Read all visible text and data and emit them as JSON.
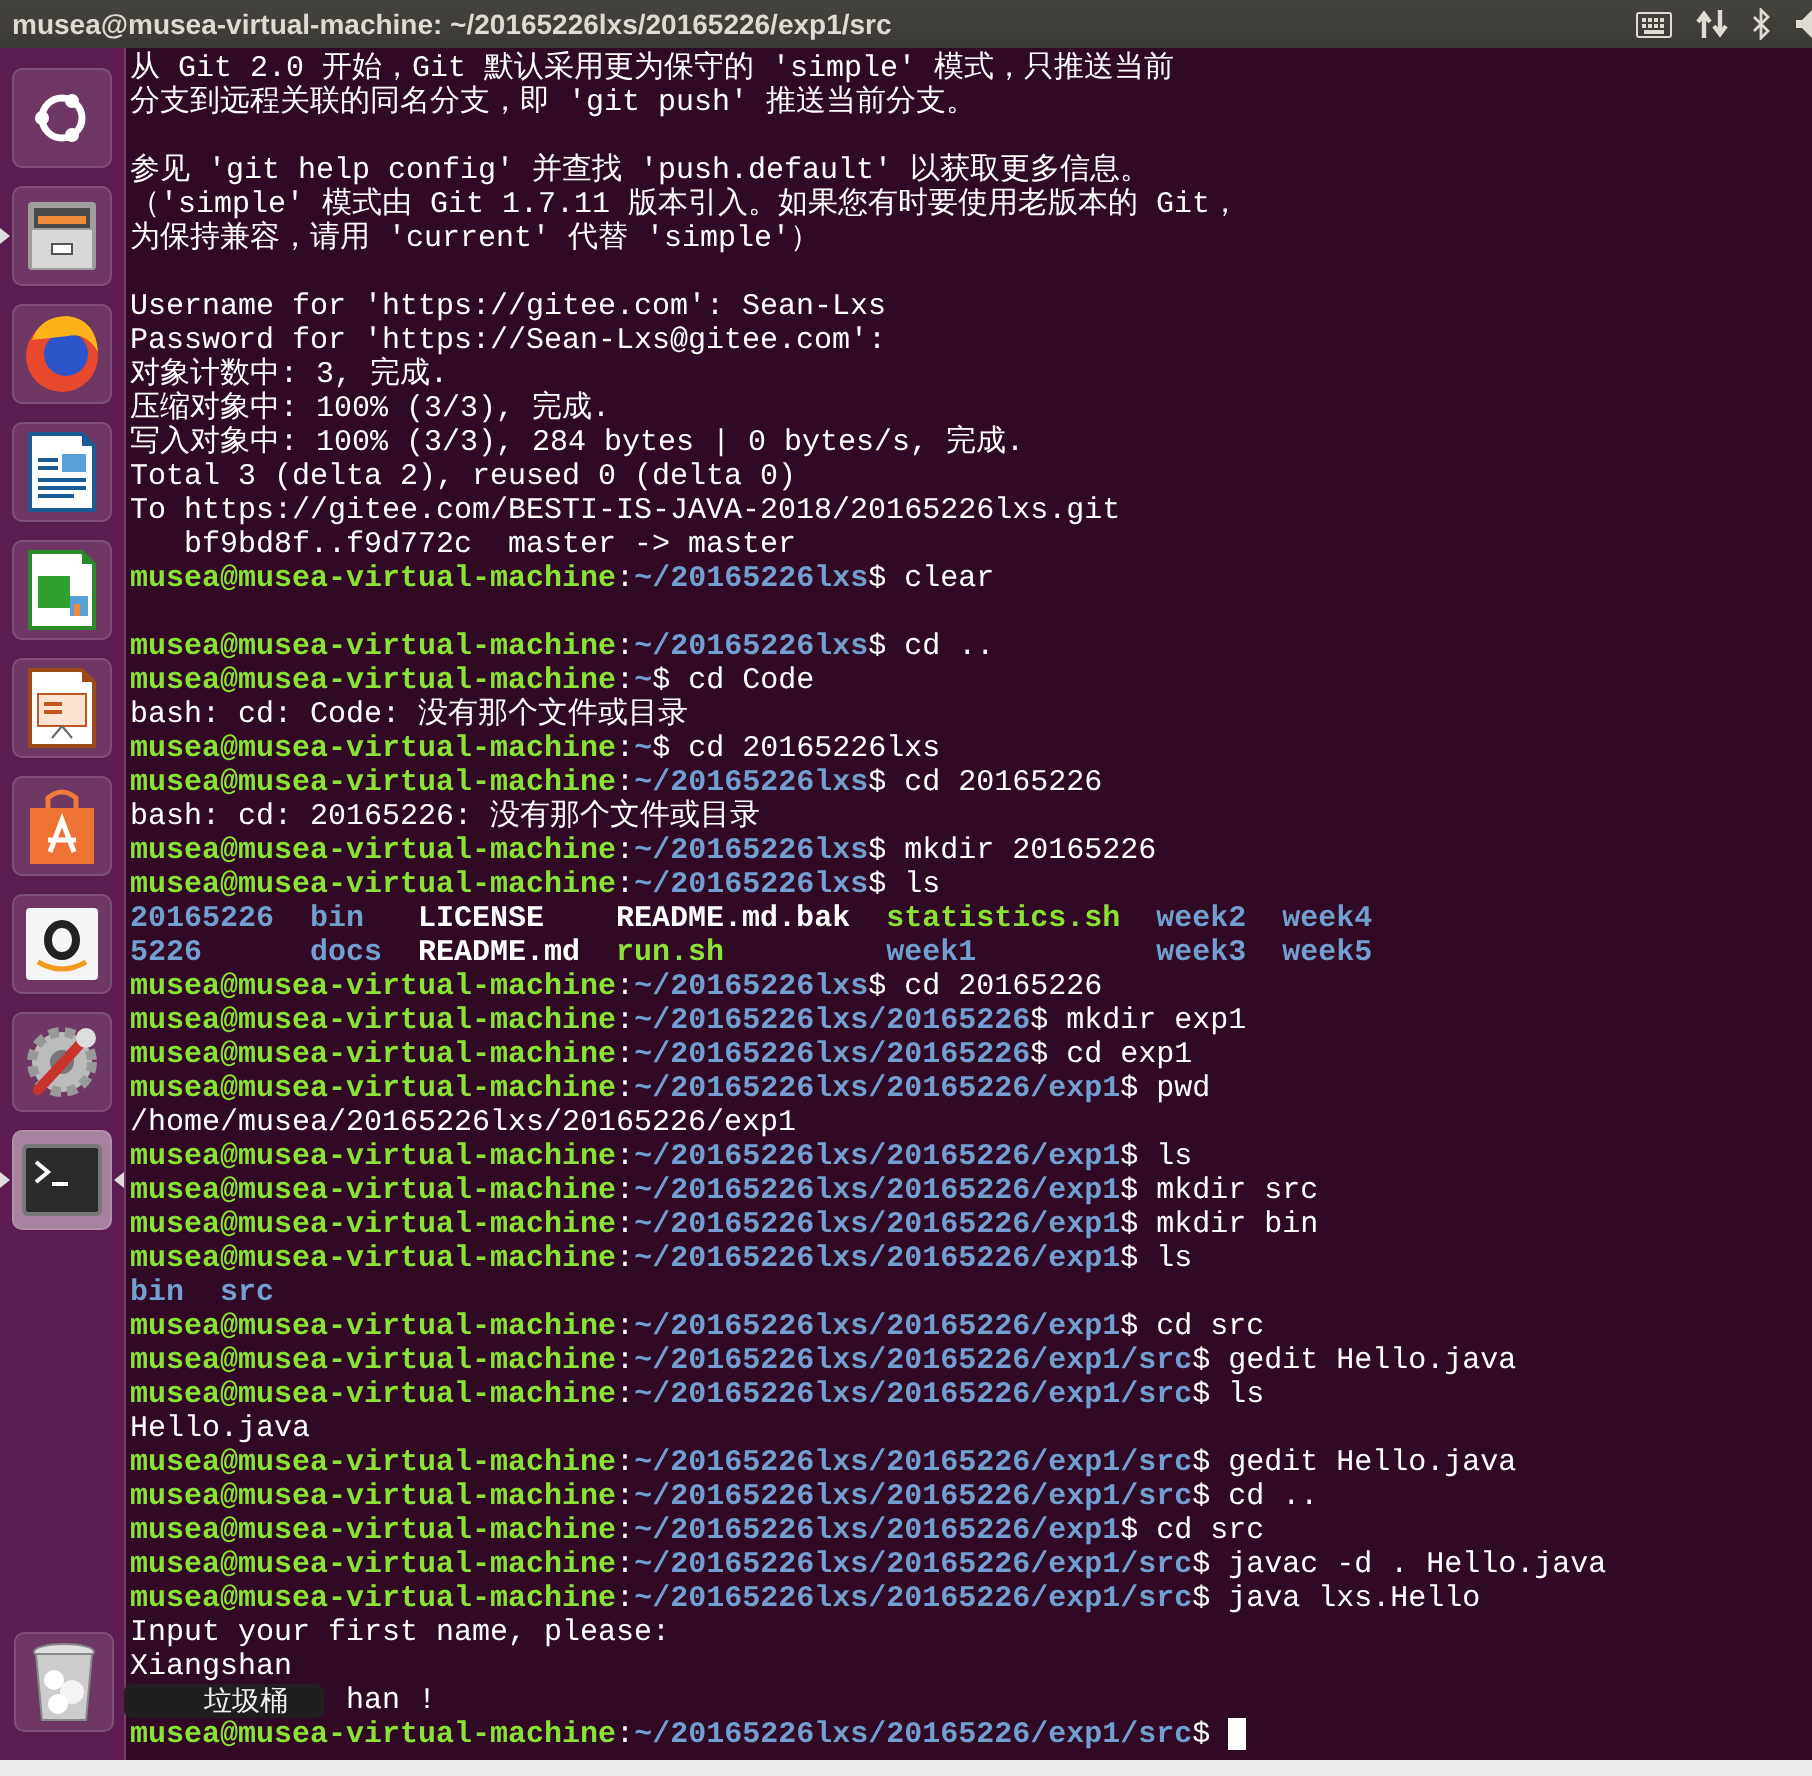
{
  "window": {
    "title": "musea@musea-virtual-machine: ~/20165226lxs/20165226/exp1/src"
  },
  "launcher": [
    {
      "kind": "dash",
      "running": false,
      "selected": false
    },
    {
      "kind": "files",
      "running": true,
      "selected": false
    },
    {
      "kind": "browser",
      "running": false,
      "selected": false
    },
    {
      "kind": "writer",
      "running": false,
      "selected": false
    },
    {
      "kind": "calc",
      "running": false,
      "selected": false
    },
    {
      "kind": "impress",
      "running": false,
      "selected": false
    },
    {
      "kind": "store",
      "running": false,
      "selected": false
    },
    {
      "kind": "shop",
      "running": false,
      "selected": false
    },
    {
      "kind": "settings",
      "running": false,
      "selected": false
    },
    {
      "kind": "terminal",
      "running": true,
      "selected": true
    }
  ],
  "trash": {
    "tooltip": "垃圾桶"
  },
  "terminal": {
    "colon": ":",
    "sign": "$",
    "lines": [
      {
        "kind": "text",
        "text": "从 Git 2.0 开始，Git 默认采用更为保守的 'simple' 模式，只推送当前"
      },
      {
        "kind": "text",
        "text": "分支到远程关联的同名分支，即 'git push' 推送当前分支。"
      },
      {
        "kind": "blank"
      },
      {
        "kind": "text",
        "text": "参见 'git help config' 并查找 'push.default' 以获取更多信息。"
      },
      {
        "kind": "text",
        "text": "（'simple' 模式由 Git 1.7.11 版本引入。如果您有时要使用老版本的 Git，"
      },
      {
        "kind": "text",
        "text": "为保持兼容，请用 'current' 代替 'simple'）"
      },
      {
        "kind": "blank"
      },
      {
        "kind": "text",
        "text": "Username for 'https://gitee.com': Sean-Lxs"
      },
      {
        "kind": "text",
        "text": "Password for 'https://Sean-Lxs@gitee.com':"
      },
      {
        "kind": "text",
        "text": "对象计数中: 3, 完成."
      },
      {
        "kind": "text",
        "text": "压缩对象中: 100% (3/3), 完成."
      },
      {
        "kind": "text",
        "text": "写入对象中: 100% (3/3), 284 bytes | 0 bytes/s, 完成."
      },
      {
        "kind": "text",
        "text": "Total 3 (delta 2), reused 0 (delta 0)"
      },
      {
        "kind": "text",
        "text": "To https://gitee.com/BESTI-IS-JAVA-2018/20165226lxs.git"
      },
      {
        "kind": "text",
        "text": "   bf9bd8f..f9d772c  master -> master"
      },
      {
        "kind": "prompt",
        "host": "musea@musea-virtual-machine",
        "path": "~/20165226lxs",
        "command": "clear"
      },
      {
        "kind": "blank"
      },
      {
        "kind": "prompt",
        "host": "musea@musea-virtual-machine",
        "path": "~/20165226lxs",
        "command": "cd .."
      },
      {
        "kind": "prompt",
        "host": "musea@musea-virtual-machine",
        "path": "~",
        "command": "cd Code"
      },
      {
        "kind": "text",
        "text": "bash: cd: Code: 没有那个文件或目录"
      },
      {
        "kind": "prompt",
        "host": "musea@musea-virtual-machine",
        "path": "~",
        "command": "cd 20165226lxs"
      },
      {
        "kind": "prompt",
        "host": "musea@musea-virtual-machine",
        "path": "~/20165226lxs",
        "command": "cd 20165226"
      },
      {
        "kind": "text",
        "text": "bash: cd: 20165226: 没有那个文件或目录"
      },
      {
        "kind": "prompt",
        "host": "musea@musea-virtual-machine",
        "path": "~/20165226lxs",
        "command": "mkdir 20165226"
      },
      {
        "kind": "prompt",
        "host": "musea@musea-virtual-machine",
        "path": "~/20165226lxs",
        "command": "ls"
      },
      {
        "kind": "listing",
        "rows": [
          [
            {
              "text": "20165226",
              "color": "#729fcf"
            },
            {
              "text": "bin",
              "color": "#729fcf"
            },
            {
              "text": "LICENSE",
              "color": "#ffffff"
            },
            {
              "text": "README.md.bak",
              "color": "#ffffff"
            },
            {
              "text": "statistics.sh",
              "color": "#8ae234"
            },
            {
              "text": "week2",
              "color": "#729fcf"
            },
            {
              "text": "week4",
              "color": "#729fcf"
            }
          ],
          [
            {
              "text": "5226",
              "color": "#729fcf"
            },
            {
              "text": "docs",
              "color": "#729fcf"
            },
            {
              "text": "README.md",
              "color": "#ffffff"
            },
            {
              "text": "run.sh",
              "color": "#8ae234"
            },
            {
              "text": "week1",
              "color": "#729fcf"
            },
            {
              "text": "week3",
              "color": "#729fcf"
            },
            {
              "text": "week5",
              "color": "#729fcf"
            }
          ]
        ]
      },
      {
        "kind": "prompt",
        "host": "musea@musea-virtual-machine",
        "path": "~/20165226lxs",
        "command": "cd 20165226"
      },
      {
        "kind": "prompt",
        "host": "musea@musea-virtual-machine",
        "path": "~/20165226lxs/20165226",
        "command": "mkdir exp1"
      },
      {
        "kind": "prompt",
        "host": "musea@musea-virtual-machine",
        "path": "~/20165226lxs/20165226",
        "command": "cd exp1"
      },
      {
        "kind": "prompt",
        "host": "musea@musea-virtual-machine",
        "path": "~/20165226lxs/20165226/exp1",
        "command": "pwd"
      },
      {
        "kind": "text",
        "text": "/home/musea/20165226lxs/20165226/exp1"
      },
      {
        "kind": "prompt",
        "host": "musea@musea-virtual-machine",
        "path": "~/20165226lxs/20165226/exp1",
        "command": "ls"
      },
      {
        "kind": "prompt",
        "host": "musea@musea-virtual-machine",
        "path": "~/20165226lxs/20165226/exp1",
        "command": "mkdir src"
      },
      {
        "kind": "prompt",
        "host": "musea@musea-virtual-machine",
        "path": "~/20165226lxs/20165226/exp1",
        "command": "mkdir bin"
      },
      {
        "kind": "prompt",
        "host": "musea@musea-virtual-machine",
        "path": "~/20165226lxs/20165226/exp1",
        "command": "ls"
      },
      {
        "kind": "listing",
        "rows": [
          [
            {
              "text": "bin",
              "color": "#729fcf"
            },
            {
              "text": "src",
              "color": "#729fcf"
            }
          ]
        ]
      },
      {
        "kind": "prompt",
        "host": "musea@musea-virtual-machine",
        "path": "~/20165226lxs/20165226/exp1",
        "command": "cd src"
      },
      {
        "kind": "prompt",
        "host": "musea@musea-virtual-machine",
        "path": "~/20165226lxs/20165226/exp1/src",
        "command": "gedit Hello.java"
      },
      {
        "kind": "prompt",
        "host": "musea@musea-virtual-machine",
        "path": "~/20165226lxs/20165226/exp1/src",
        "command": "ls"
      },
      {
        "kind": "text",
        "text": "Hello.java"
      },
      {
        "kind": "prompt",
        "host": "musea@musea-virtual-machine",
        "path": "~/20165226lxs/20165226/exp1/src",
        "command": "gedit Hello.java"
      },
      {
        "kind": "prompt",
        "host": "musea@musea-virtual-machine",
        "path": "~/20165226lxs/20165226/exp1/src",
        "command": "cd .."
      },
      {
        "kind": "prompt",
        "host": "musea@musea-virtual-machine",
        "path": "~/20165226lxs/20165226/exp1",
        "command": "cd src"
      },
      {
        "kind": "prompt",
        "host": "musea@musea-virtual-machine",
        "path": "~/20165226lxs/20165226/exp1/src",
        "command": "javac -d . Hello.java"
      },
      {
        "kind": "prompt",
        "host": "musea@musea-virtual-machine",
        "path": "~/20165226lxs/20165226/exp1/src",
        "command": "java lxs.Hello"
      },
      {
        "kind": "text",
        "text": "Input your first name, please:"
      },
      {
        "kind": "text",
        "text": "Xiangshan"
      },
      {
        "kind": "covered",
        "text": "han !"
      },
      {
        "kind": "prompt",
        "host": "musea@musea-virtual-machine",
        "path": "~/20165226lxs/20165226/exp1/src",
        "cursor": true
      }
    ]
  }
}
